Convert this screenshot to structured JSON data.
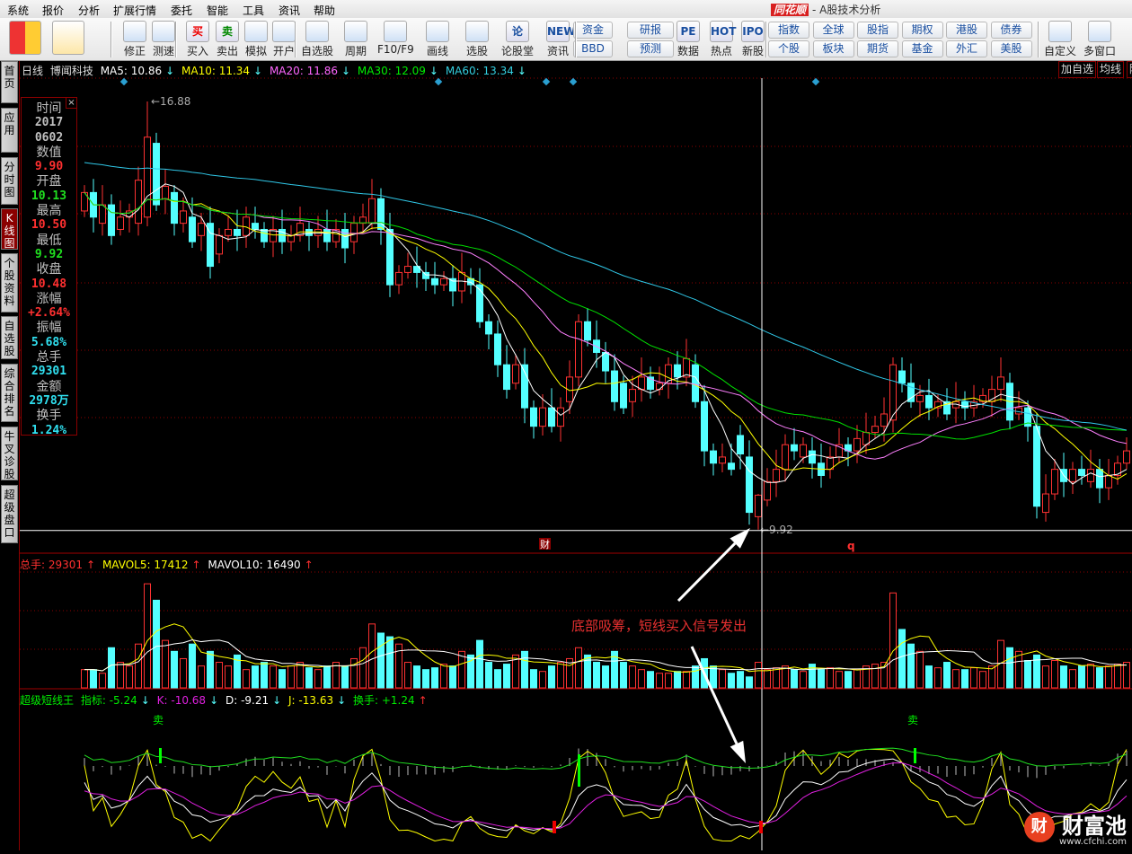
{
  "menu": [
    "系统",
    "报价",
    "分析",
    "扩展行情",
    "委托",
    "智能",
    "工具",
    "资讯",
    "帮助"
  ],
  "app_title": {
    "logo": "同花顺",
    "subtitle": "- A股技术分析"
  },
  "toolbar": {
    "buttons": [
      {
        "label": "",
        "icon": "color-grid-icon"
      },
      {
        "label": "",
        "icon": "back-arrow-icon"
      },
      {
        "label": "修正",
        "icon": "refresh-icon"
      },
      {
        "label": "测速",
        "icon": "clock-icon"
      },
      {
        "label": "买入",
        "icon": "buy-icon",
        "glyph": "买"
      },
      {
        "label": "卖出",
        "icon": "sell-icon",
        "glyph": "卖"
      },
      {
        "label": "模拟",
        "icon": "gavel-icon"
      },
      {
        "label": "开户",
        "icon": "lock-icon"
      },
      {
        "label": "自选股",
        "icon": "star-folder-icon"
      },
      {
        "label": "周期",
        "icon": "period-clock-icon"
      },
      {
        "label": "F10/F9",
        "icon": "document-icon"
      },
      {
        "label": "画线",
        "icon": "pencil-icon"
      },
      {
        "label": "选股",
        "icon": "radar-icon"
      },
      {
        "label": "论股堂",
        "icon": "forum-icon",
        "glyph": "论"
      },
      {
        "label": "资讯",
        "icon": "news-icon",
        "glyph": "NEWS"
      },
      {
        "label": "数据",
        "icon": "pe-icon",
        "glyph": "PE"
      },
      {
        "label": "热点",
        "icon": "hot-icon",
        "glyph": "HOT"
      },
      {
        "label": "新股",
        "icon": "ipo-icon",
        "glyph": "IPO"
      },
      {
        "label": "自定义",
        "icon": "customize-icon"
      },
      {
        "label": "多窗口",
        "icon": "multi-window-icon"
      }
    ],
    "small_buttons": [
      "资金",
      "研报",
      "BBD",
      "预测"
    ],
    "market_buttons": [
      "指数",
      "全球",
      "股指",
      "期权",
      "港股",
      "债券",
      "个股",
      "板块",
      "期货",
      "基金",
      "外汇",
      "美股"
    ]
  },
  "side_tabs": [
    "首页",
    "应用",
    "分时图",
    "K线图",
    "个股资料",
    "自选股",
    "综合排名",
    "牛叉诊股",
    "超级盘口"
  ],
  "price_header": {
    "period": "日线",
    "stock": "博闻科技",
    "ma5": "MA5: 10.86",
    "ma10": "MA10: 11.34",
    "ma20": "MA20: 11.86",
    "ma30": "MA30: 12.09",
    "ma60": "MA60: 13.34",
    "arrow": "↓"
  },
  "right_buttons": [
    "加自选",
    "均线",
    "除"
  ],
  "info_panel": {
    "rows": [
      {
        "k": "时间",
        "v": "2017"
      },
      {
        "k": "",
        "v": "0602"
      },
      {
        "k": "数值",
        "v": "9.90",
        "c": "#ff3030"
      },
      {
        "k": "开盘",
        "v": "10.13",
        "c": "#20e020"
      },
      {
        "k": "最高",
        "v": "10.50",
        "c": "#ff3030"
      },
      {
        "k": "最低",
        "v": "9.92",
        "c": "#20e020"
      },
      {
        "k": "收盘",
        "v": "10.48",
        "c": "#ff3030"
      },
      {
        "k": "涨幅",
        "v": "+2.64%",
        "c": "#ff3030"
      },
      {
        "k": "振幅",
        "v": "5.68%",
        "c": "#30e0f0"
      },
      {
        "k": "总手",
        "v": "29301",
        "c": "#30e0f0"
      },
      {
        "k": "金额",
        "v": "2978万",
        "c": "#30e0f0"
      },
      {
        "k": "换手",
        "v": "1.24%",
        "c": "#30e0f0"
      }
    ],
    "close": "×"
  },
  "volume_header": {
    "total": "总手: 29301",
    "mavol5": "MAVOL5: 17412",
    "mavol10": "MAVOL10: 16490",
    "arrow": "↑"
  },
  "indicator_header": {
    "name": "超级短线王",
    "idx": "指标: -5.24",
    "k": "K: -10.68",
    "d": "D: -9.21",
    "j": "J: -13.63",
    "turnover": "换手: +1.24",
    "down": "↓",
    "up": "↑"
  },
  "annotation": "底部吸筹，短线买入信号发出",
  "markers": {
    "cai": "财",
    "q": "q",
    "sell": "卖",
    "high_label": "16.88",
    "low_label": "9.92"
  },
  "watermark": {
    "text": "财富池",
    "logo": "财",
    "url": "www.cfchi.com"
  },
  "colors": {
    "up": "#ff3232",
    "down": "#54ffff",
    "ma5": "#ffffff",
    "ma10": "#ffff00",
    "ma20": "#ff80ff",
    "ma30": "#00e000",
    "ma60": "#30c8e8"
  },
  "chart_data": {
    "type": "candlestick",
    "price_range": [
      9.92,
      16.88
    ],
    "candles_oc": [
      [
        15.1,
        15.4
      ],
      [
        15.4,
        15.0
      ],
      [
        14.9,
        15.2
      ],
      [
        15.2,
        14.7
      ],
      [
        14.8,
        15.0
      ],
      [
        15.0,
        15.1
      ],
      [
        14.9,
        15.6
      ],
      [
        15.0,
        16.3
      ],
      [
        16.2,
        15.2
      ],
      [
        15.3,
        15.5
      ],
      [
        15.4,
        14.9
      ],
      [
        14.9,
        15.1
      ],
      [
        15.0,
        14.6
      ],
      [
        14.7,
        14.9
      ],
      [
        14.9,
        14.2
      ],
      [
        14.4,
        14.7
      ],
      [
        14.7,
        14.8
      ],
      [
        14.8,
        14.7
      ],
      [
        14.7,
        15.0
      ],
      [
        14.9,
        14.8
      ],
      [
        14.8,
        14.6
      ],
      [
        14.6,
        14.8
      ],
      [
        14.8,
        14.6
      ],
      [
        14.6,
        14.7
      ],
      [
        14.7,
        14.9
      ],
      [
        14.8,
        14.7
      ],
      [
        14.7,
        14.8
      ],
      [
        14.8,
        14.6
      ],
      [
        14.6,
        14.8
      ],
      [
        14.8,
        14.5
      ],
      [
        14.6,
        14.9
      ],
      [
        14.9,
        15.0
      ],
      [
        14.9,
        15.3
      ],
      [
        15.3,
        14.8
      ],
      [
        14.8,
        13.9
      ],
      [
        13.9,
        14.1
      ],
      [
        14.1,
        14.2
      ],
      [
        14.2,
        14.1
      ],
      [
        14.1,
        14.0
      ],
      [
        14.0,
        13.9
      ],
      [
        13.9,
        14.0
      ],
      [
        14.0,
        13.8
      ],
      [
        13.8,
        14.1
      ],
      [
        14.0,
        13.9
      ],
      [
        13.9,
        13.3
      ],
      [
        13.3,
        13.1
      ],
      [
        13.1,
        12.6
      ],
      [
        12.6,
        12.2
      ],
      [
        12.3,
        12.6
      ],
      [
        12.6,
        11.9
      ],
      [
        11.9,
        11.6
      ],
      [
        11.6,
        11.9
      ],
      [
        11.9,
        11.6
      ],
      [
        11.6,
        11.9
      ],
      [
        12.0,
        12.4
      ],
      [
        12.4,
        13.3
      ],
      [
        13.3,
        13.0
      ],
      [
        13.0,
        12.8
      ],
      [
        12.8,
        12.5
      ],
      [
        12.5,
        12.0
      ],
      [
        12.3,
        11.9
      ],
      [
        12.0,
        12.2
      ],
      [
        12.2,
        12.4
      ],
      [
        12.4,
        12.2
      ],
      [
        12.2,
        12.3
      ],
      [
        12.3,
        12.6
      ],
      [
        12.6,
        12.4
      ],
      [
        12.4,
        12.7
      ],
      [
        12.6,
        12.0
      ],
      [
        12.0,
        11.2
      ],
      [
        11.2,
        11.0
      ],
      [
        11.0,
        11.1
      ],
      [
        11.0,
        10.9
      ],
      [
        11.45,
        11.15
      ],
      [
        11.1,
        10.2
      ],
      [
        10.13,
        10.48
      ],
      [
        10.4,
        10.7
      ],
      [
        10.7,
        10.9
      ],
      [
        10.9,
        11.3
      ],
      [
        11.3,
        11.2
      ],
      [
        11.1,
        11.3
      ],
      [
        11.2,
        11.0
      ],
      [
        11.0,
        10.8
      ],
      [
        10.9,
        11.1
      ],
      [
        11.1,
        11.3
      ],
      [
        11.3,
        11.2
      ],
      [
        11.2,
        11.4
      ],
      [
        11.3,
        11.5
      ],
      [
        11.5,
        11.6
      ],
      [
        11.6,
        11.8
      ],
      [
        11.7,
        12.6
      ],
      [
        12.5,
        12.3
      ],
      [
        12.3,
        12.0
      ],
      [
        12.0,
        12.1
      ],
      [
        12.1,
        11.9
      ],
      [
        11.9,
        12.0
      ],
      [
        12.0,
        11.8
      ],
      [
        11.9,
        12.0
      ],
      [
        12.0,
        11.9
      ],
      [
        11.9,
        12.0
      ],
      [
        12.0,
        12.1
      ],
      [
        12.0,
        12.2
      ],
      [
        12.2,
        12.4
      ],
      [
        12.3,
        11.7
      ],
      [
        11.8,
        11.9
      ],
      [
        11.9,
        11.6
      ],
      [
        11.6,
        10.3
      ],
      [
        10.2,
        10.5
      ],
      [
        10.5,
        10.9
      ],
      [
        10.9,
        10.7
      ],
      [
        10.7,
        10.9
      ],
      [
        10.9,
        10.8
      ],
      [
        10.7,
        10.9
      ],
      [
        10.9,
        10.6
      ],
      [
        10.6,
        10.8
      ],
      [
        10.8,
        11.0
      ],
      [
        11.0,
        11.2
      ]
    ],
    "volumes": [
      10000,
      10000,
      8000,
      22000,
      14000,
      12000,
      24000,
      57000,
      48000,
      26000,
      20000,
      16000,
      24000,
      12000,
      20000,
      14000,
      12000,
      18000,
      10000,
      12000,
      14000,
      12000,
      10000,
      12000,
      14000,
      11000,
      10000,
      12000,
      14000,
      12000,
      16000,
      22000,
      35000,
      30000,
      28000,
      24000,
      14000,
      12000,
      10000,
      11000,
      13000,
      12000,
      20000,
      18000,
      26000,
      14000,
      10000,
      13000,
      18000,
      20000,
      10000,
      9000,
      12000,
      14000,
      16000,
      22000,
      18000,
      14000,
      12000,
      20000,
      14000,
      12000,
      10000,
      9000,
      8000,
      8000,
      9000,
      9000,
      12000,
      16000,
      12000,
      10000,
      8000,
      9000,
      6000,
      14000,
      10000,
      11000,
      12000,
      10000,
      9000,
      13000,
      10000,
      11000,
      9000,
      9000,
      10000,
      12000,
      13000,
      14000,
      52000,
      32000,
      24000,
      20000,
      12000,
      11000,
      14000,
      10000,
      10000,
      11000,
      9000,
      12000,
      26000,
      22000,
      20000,
      15000,
      18000,
      12000,
      15000,
      12000,
      10000,
      12000,
      13000,
      11000,
      12000,
      13000,
      14000
    ],
    "sell_signals": [
      8,
      92
    ],
    "buy_bars": [
      52,
      75
    ],
    "crosshair_index": 75
  }
}
